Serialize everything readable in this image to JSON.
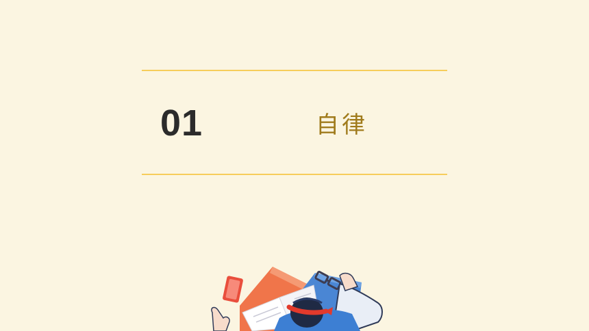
{
  "section": {
    "number": "01",
    "title": "自律"
  },
  "colors": {
    "background": "#fbf5e1",
    "rule": "#f6cd5a",
    "number": "#2b2b2b",
    "title": "#a07b1c"
  },
  "illustration": {
    "icon": "student-sleeping-on-books-illustration"
  }
}
